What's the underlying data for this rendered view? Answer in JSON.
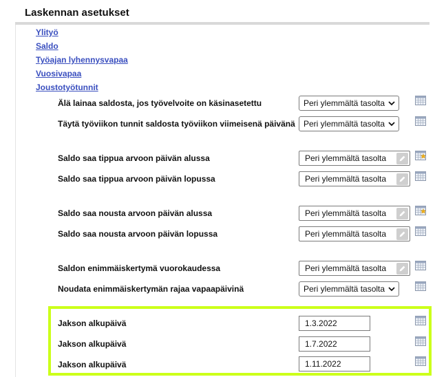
{
  "page": {
    "title": "Laskennan asetukset"
  },
  "nav_links": [
    "Ylityö",
    "Saldo",
    "Työajan lyhennysvapaa",
    "Vuosivapaa",
    "Joustotyötunnit"
  ],
  "settings": [
    {
      "label": "Älä lainaa saldosta, jos työvelvoite on käsinasetettu",
      "value": "Peri ylemmältä tasolta",
      "control": "select",
      "icon": "calendar-grid-icon"
    },
    {
      "label": "Täytä työviikon tunnit saldosta työviikon viimeisenä päivänä",
      "value": "Peri ylemmältä tasolta",
      "control": "select",
      "icon": "calendar-grid-icon"
    },
    {
      "label": "Saldo saa tippua arvoon päivän alussa",
      "value": "Peri ylemmältä tasolta",
      "control": "edit",
      "icon": "calendar-star-icon"
    },
    {
      "label": "Saldo saa tippua arvoon päivän lopussa",
      "value": "Peri ylemmältä tasolta",
      "control": "edit",
      "icon": "calendar-grid-icon"
    },
    {
      "label": "Saldo saa nousta arvoon päivän alussa",
      "value": "Peri ylemmältä tasolta",
      "control": "edit",
      "icon": "calendar-star-icon"
    },
    {
      "label": "Saldo saa nousta arvoon päivän lopussa",
      "value": "Peri ylemmältä tasolta",
      "control": "edit",
      "icon": "calendar-grid-icon"
    },
    {
      "label": "Saldon enimmäiskertymä vuorokaudessa",
      "value": "Peri ylemmältä tasolta",
      "control": "edit",
      "icon": "calendar-grid-icon"
    },
    {
      "label": "Noudata enimmäiskertymän rajaa vapaapäivinä",
      "value": "Peri ylemmältä tasolta",
      "control": "select",
      "icon": "calendar-grid-icon"
    }
  ],
  "periods": [
    {
      "label": "Jakson alkupäivä",
      "value": "1.3.2022"
    },
    {
      "label": "Jakson alkupäivä",
      "value": "1.7.2022"
    },
    {
      "label": "Jakson alkupäivä",
      "value": "1.11.2022"
    }
  ],
  "colors": {
    "link": "#3a4fbf",
    "highlight": "#ccff1a",
    "rule": "#d9d9d9"
  }
}
